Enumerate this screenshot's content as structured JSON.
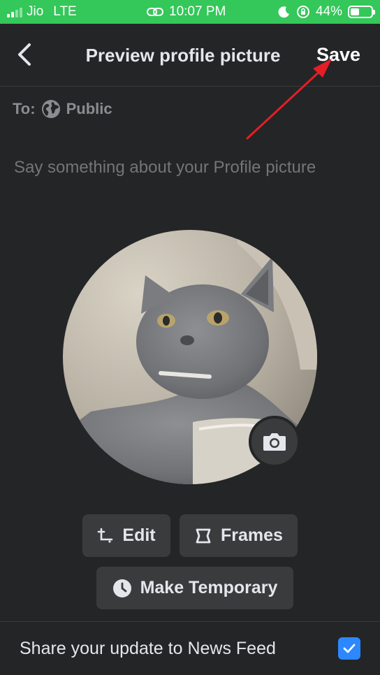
{
  "status_bar": {
    "carrier": "Jio",
    "network": "LTE",
    "time": "10:07 PM",
    "battery": "44%",
    "battery_level": 0.44,
    "bg_color": "#34c759"
  },
  "header": {
    "title": "Preview profile picture",
    "save_label": "Save",
    "back_icon": "chevron-left-icon"
  },
  "audience": {
    "prefix": "To:",
    "value": "Public",
    "icon": "globe-icon"
  },
  "caption": {
    "placeholder": "Say something about your Profile picture"
  },
  "profile": {
    "image_alt": "Profile picture",
    "camera_icon": "camera-icon"
  },
  "actions": {
    "edit_label": "Edit",
    "frames_label": "Frames",
    "temporary_label": "Make Temporary"
  },
  "share": {
    "label": "Share your update to News Feed",
    "checked": true,
    "check_color": "#2d88ff"
  },
  "colors": {
    "background": "#242526",
    "button_bg": "#3a3b3c",
    "annotation_arrow": "#e41e26"
  }
}
